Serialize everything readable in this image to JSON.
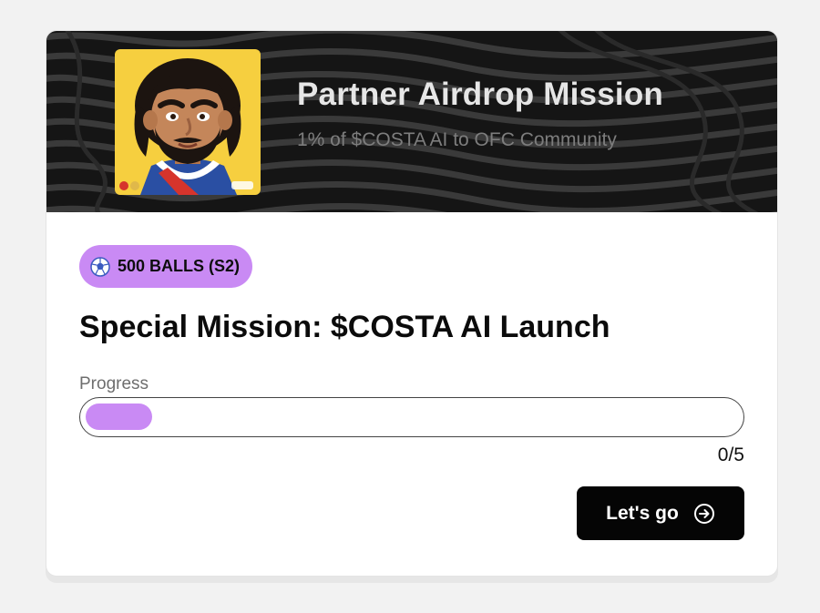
{
  "banner": {
    "title": "Partner Airdrop Mission",
    "subtitle": "1% of $COSTA AI to OFC Community",
    "avatar_icon": "costa-character-avatar",
    "background_color": "#151515",
    "avatar_background": "#f6cf3f"
  },
  "reward_badge": {
    "icon": "soccer-ball-icon",
    "label": "500 BALLS (S2)",
    "color": "#c98af4"
  },
  "mission": {
    "title": "Special Mission: $COSTA AI Launch"
  },
  "progress": {
    "label": "Progress",
    "current": 0,
    "total": 5,
    "display": "0/5",
    "fill_color": "#c98af4"
  },
  "action": {
    "label": "Let's go",
    "icon": "arrow-right-circle-icon",
    "background": "#050505"
  }
}
